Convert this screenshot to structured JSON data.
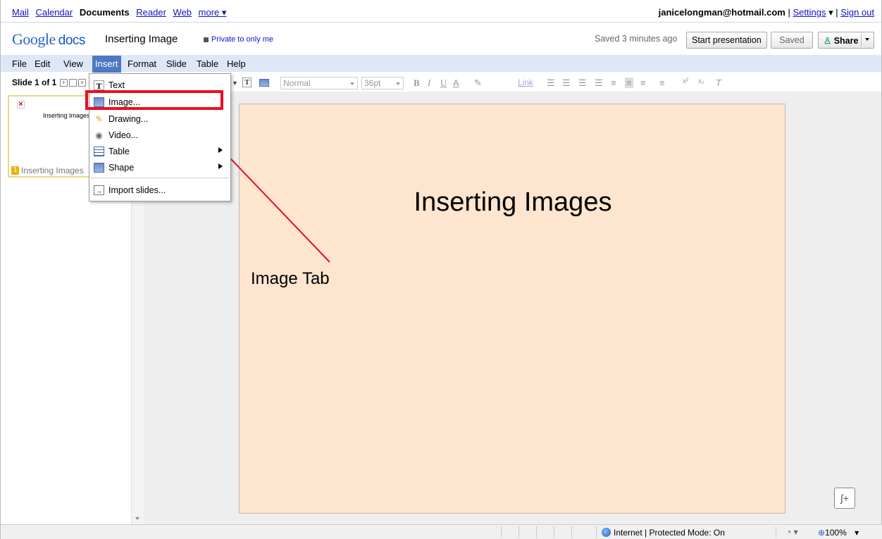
{
  "gbar": {
    "links": [
      "Mail",
      "Calendar",
      "Documents",
      "Reader",
      "Web",
      "more ▾"
    ],
    "active": "Documents",
    "account": "janicelongman@hotmail.com",
    "settings": "Settings",
    "settings_caret": "▾",
    "signout": "Sign out",
    "sep": "|"
  },
  "header": {
    "logo_google": "Google",
    "logo_docs": "docs",
    "doc_title": "Inserting Image",
    "privacy": "Private to only me",
    "saved_ago": "Saved 3 minutes ago",
    "start_presentation": "Start presentation",
    "saved_button": "Saved",
    "share_button": "Share"
  },
  "menubar": {
    "items": [
      "File",
      "Edit",
      "View",
      "Insert",
      "Format",
      "Slide",
      "Table",
      "Help"
    ],
    "active": "Insert"
  },
  "toolbar": {
    "slide_info": "Slide 1 of 1",
    "style_value": "Normal",
    "size_value": "36pt",
    "link_label": "Link"
  },
  "insert_menu": {
    "items": [
      {
        "label": "Text",
        "icon": "text-icon"
      },
      {
        "label": "Image...",
        "icon": "image-icon"
      },
      {
        "label": "Drawing...",
        "icon": "drawing-icon"
      },
      {
        "label": "Video...",
        "icon": "video-icon"
      },
      {
        "label": "Table",
        "icon": "table-icon",
        "submenu": true
      },
      {
        "label": "Shape",
        "icon": "shape-icon",
        "submenu": true
      },
      {
        "label": "Import slides...",
        "icon": "import-icon"
      }
    ]
  },
  "slides_panel": {
    "thumb_title": "Inserting Images",
    "thumb_number": "1",
    "thumb_label": "Inserting Images"
  },
  "slide": {
    "title": "Inserting Images",
    "background": "#fde5cf"
  },
  "annotation": {
    "label": "Image Tab",
    "color": "#e81020"
  },
  "statusbar": {
    "zone": "Internet | Protected Mode: On",
    "zoom": "100%"
  }
}
